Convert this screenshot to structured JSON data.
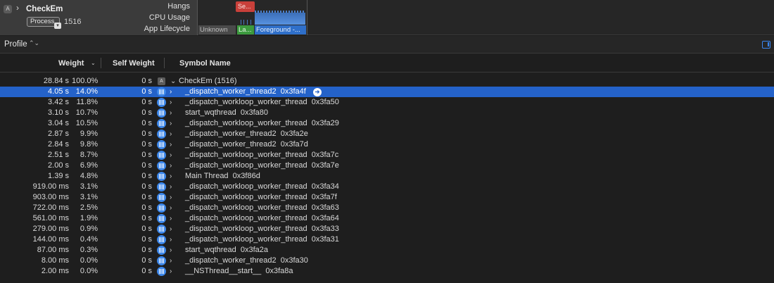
{
  "track": {
    "process_name": "CheckEm",
    "process_pill": "Process",
    "process_id": "1516",
    "labels": {
      "hangs": "Hangs",
      "cpu": "CPU Usage",
      "lifecycle": "App Lifecycle"
    },
    "hang_block": "Se...",
    "lifecycle": {
      "unknown": "Unknown",
      "launch": "La...",
      "foreground": "Foreground -..."
    }
  },
  "profile": {
    "label": "Profile"
  },
  "columns": {
    "weight": "Weight",
    "self_weight": "Self Weight",
    "symbol": "Symbol Name"
  },
  "root": {
    "weight": "28.84 s",
    "pct": "100.0%",
    "self": "0 s",
    "symbol": "CheckEm (1516)"
  },
  "rows": [
    {
      "weight": "4.05 s",
      "pct": "14.0%",
      "self": "0 s",
      "symbol": "_dispatch_worker_thread2  0x3fa4f",
      "selected": true
    },
    {
      "weight": "3.42 s",
      "pct": "11.8%",
      "self": "0 s",
      "symbol": "_dispatch_workloop_worker_thread  0x3fa50"
    },
    {
      "weight": "3.10 s",
      "pct": "10.7%",
      "self": "0 s",
      "symbol": "start_wqthread  0x3fa80"
    },
    {
      "weight": "3.04 s",
      "pct": "10.5%",
      "self": "0 s",
      "symbol": "_dispatch_workloop_worker_thread  0x3fa29"
    },
    {
      "weight": "2.87 s",
      "pct": "9.9%",
      "self": "0 s",
      "symbol": "_dispatch_worker_thread2  0x3fa2e"
    },
    {
      "weight": "2.84 s",
      "pct": "9.8%",
      "self": "0 s",
      "symbol": "_dispatch_worker_thread2  0x3fa7d"
    },
    {
      "weight": "2.51 s",
      "pct": "8.7%",
      "self": "0 s",
      "symbol": "_dispatch_workloop_worker_thread  0x3fa7c"
    },
    {
      "weight": "2.00 s",
      "pct": "6.9%",
      "self": "0 s",
      "symbol": "_dispatch_workloop_worker_thread  0x3fa7e"
    },
    {
      "weight": "1.39 s",
      "pct": "4.8%",
      "self": "0 s",
      "symbol": "Main Thread  0x3f86d"
    },
    {
      "weight": "919.00 ms",
      "pct": "3.1%",
      "self": "0 s",
      "symbol": "_dispatch_workloop_worker_thread  0x3fa34"
    },
    {
      "weight": "903.00 ms",
      "pct": "3.1%",
      "self": "0 s",
      "symbol": "_dispatch_workloop_worker_thread  0x3fa7f"
    },
    {
      "weight": "722.00 ms",
      "pct": "2.5%",
      "self": "0 s",
      "symbol": "_dispatch_workloop_worker_thread  0x3fa63"
    },
    {
      "weight": "561.00 ms",
      "pct": "1.9%",
      "self": "0 s",
      "symbol": "_dispatch_workloop_worker_thread  0x3fa64"
    },
    {
      "weight": "279.00 ms",
      "pct": "0.9%",
      "self": "0 s",
      "symbol": "_dispatch_workloop_worker_thread  0x3fa33"
    },
    {
      "weight": "144.00 ms",
      "pct": "0.4%",
      "self": "0 s",
      "symbol": "_dispatch_workloop_worker_thread  0x3fa31"
    },
    {
      "weight": "87.00 ms",
      "pct": "0.3%",
      "self": "0 s",
      "symbol": "start_wqthread  0x3fa2a"
    },
    {
      "weight": "8.00 ms",
      "pct": "0.0%",
      "self": "0 s",
      "symbol": "_dispatch_worker_thread2  0x3fa30"
    },
    {
      "weight": "2.00 ms",
      "pct": "0.0%",
      "self": "0 s",
      "symbol": "__NSThread__start__  0x3fa8a"
    }
  ],
  "colors": {
    "selection": "#2462c9",
    "accent": "#3b86ea",
    "hang": "#c9403a",
    "launch": "#3c9a3e"
  }
}
